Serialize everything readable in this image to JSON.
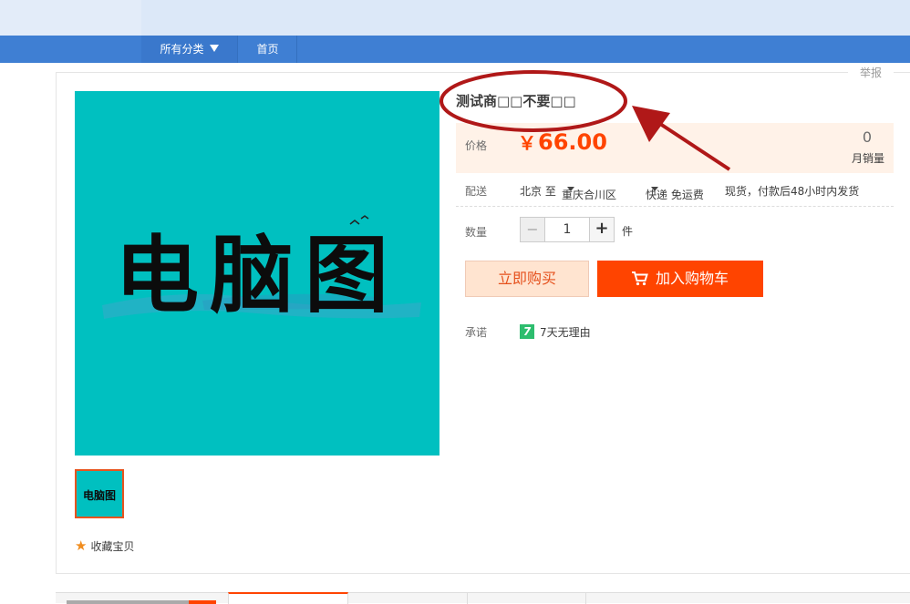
{
  "nav": {
    "category_label": "所有分类",
    "home_label": "首页"
  },
  "report_label": "举报",
  "product": {
    "title": "测试商□□不要□□",
    "image_text": "电脑图",
    "favorite_label": "收藏宝贝"
  },
  "price": {
    "label": "价格",
    "currency": "￥",
    "value": "66.00",
    "monthly_sales_count": "0",
    "monthly_sales_label": "月销量"
  },
  "shipping": {
    "label": "配送",
    "from": "北京 至",
    "to": "重庆合川区",
    "method": "快递 免运费",
    "note": "现货，付款后48小时内发货"
  },
  "quantity": {
    "label": "数量",
    "value": "1",
    "unit": "件",
    "minus_symbol": "−",
    "plus_symbol": "+"
  },
  "actions": {
    "buy_now": "立即购买",
    "add_to_cart": "加入购物车"
  },
  "promise": {
    "label": "承诺",
    "badge": "7",
    "text": "7天无理由"
  },
  "colors": {
    "accent": "#ff4400",
    "nav_blue": "#3f7fd3",
    "image_bg": "#00c0c0",
    "annotation_red": "#b01818"
  },
  "icons": {
    "cart": "cart-icon",
    "star": "star-icon",
    "dropdown": "caret-down-icon"
  }
}
